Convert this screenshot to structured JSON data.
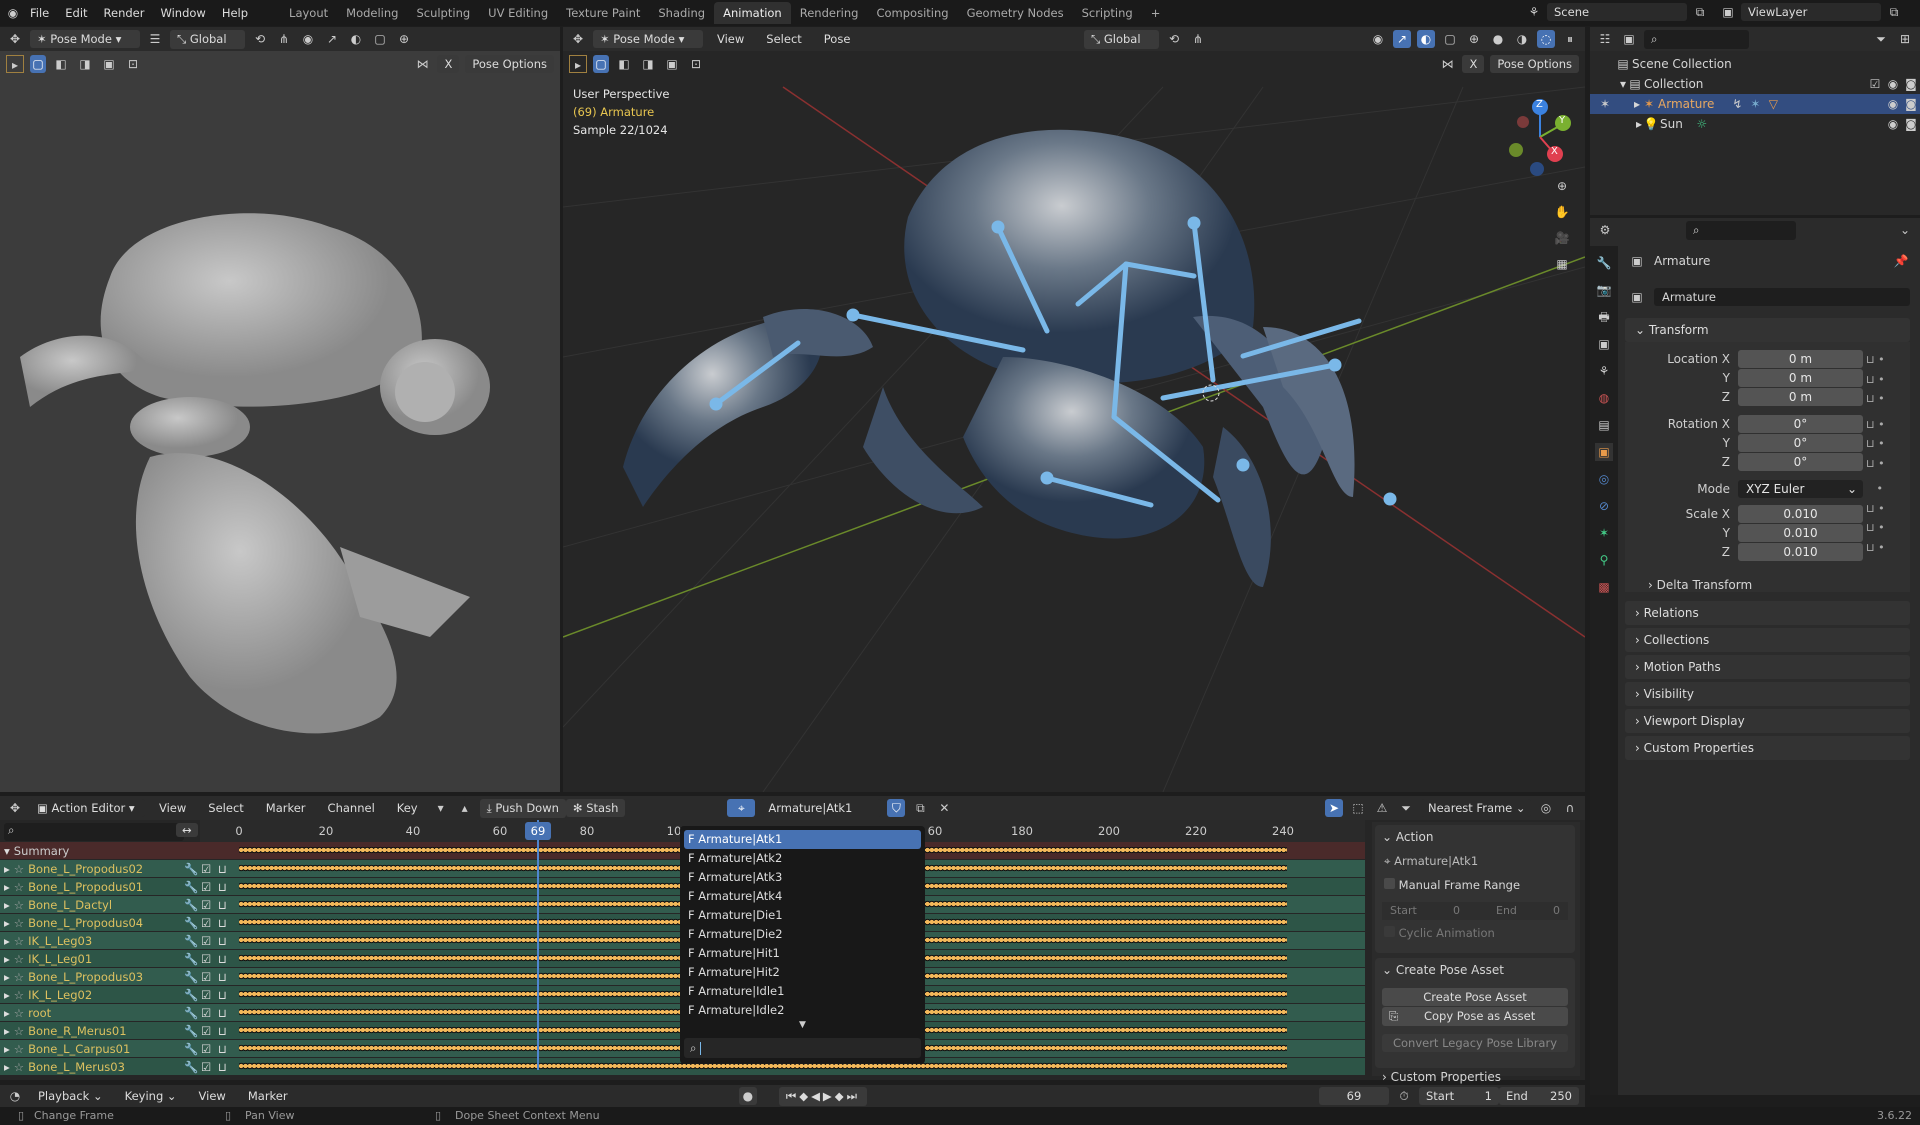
{
  "menu": [
    "File",
    "Edit",
    "Render",
    "Window",
    "Help"
  ],
  "workspaces": [
    "Layout",
    "Modeling",
    "Sculpting",
    "UV Editing",
    "Texture Paint",
    "Shading",
    "Animation",
    "Rendering",
    "Compositing",
    "Geometry Nodes",
    "Scripting"
  ],
  "active_workspace": "Animation",
  "scene": "Scene",
  "view_layer": "ViewLayer",
  "left_viewport": {
    "mode": "Pose Mode",
    "orientation": "Global",
    "pose_options": "Pose Options",
    "x_label": "X"
  },
  "main_viewport": {
    "mode": "Pose Mode",
    "menus": [
      "View",
      "Select",
      "Pose"
    ],
    "orientation": "Global",
    "pose_options": "Pose Options",
    "x_label": "X",
    "overlay": {
      "perspective": "User Perspective",
      "object": "(69) Armature",
      "sample": "Sample 22/1024"
    },
    "gizmo": {
      "z": "Z",
      "y": "Y",
      "x": "X"
    }
  },
  "outliner": {
    "items": [
      {
        "label": "Scene Collection"
      },
      {
        "label": "Collection"
      },
      {
        "label": "Armature"
      },
      {
        "label": "Sun"
      }
    ]
  },
  "properties": {
    "object_name": "Armature",
    "data_name": "Armature",
    "transform_title": "Transform",
    "location_label": "Location X",
    "rotation_label": "Rotation X",
    "scale_label": "Scale X",
    "y": "Y",
    "z": "Z",
    "location": [
      "0 m",
      "0 m",
      "0 m"
    ],
    "rotation": [
      "0°",
      "0°",
      "0°"
    ],
    "mode_label": "Mode",
    "mode": "XYZ Euler",
    "scale": [
      "0.010",
      "0.010",
      "0.010"
    ],
    "delta": "Delta Transform",
    "panels": [
      "Relations",
      "Collections",
      "Motion Paths",
      "Visibility",
      "Viewport Display",
      "Custom Properties"
    ]
  },
  "dopesheet": {
    "editor": "Action Editor",
    "menus": [
      "View",
      "Select",
      "Marker",
      "Channel",
      "Key"
    ],
    "push_down": "Push Down",
    "stash": "Stash",
    "action": "Armature|Atk1",
    "snap": "Nearest Frame",
    "ruler": [
      "0",
      "20",
      "40",
      "60",
      "80",
      "10",
      "60",
      "180",
      "200",
      "220",
      "240"
    ],
    "current_frame": "69",
    "summary": "Summary",
    "channels": [
      "Bone_L_Propodus02",
      "Bone_L_Propodus01",
      "Bone_L_Dactyl",
      "Bone_L_Propodus04",
      "IK_L_Leg03",
      "IK_L_Leg01",
      "Bone_L_Propodus03",
      "IK_L_Leg02",
      "root",
      "Bone_R_Merus01",
      "Bone_L_Carpus01",
      "Bone_L_Merus03"
    ],
    "action_list": [
      "F Armature|Atk1",
      "F Armature|Atk2",
      "F Armature|Atk3",
      "F Armature|Atk4",
      "F Armature|Die1",
      "F Armature|Die2",
      "F Armature|Hit1",
      "F Armature|Hit2",
      "F Armature|Idle1",
      "F Armature|Idle2"
    ]
  },
  "sidebar": {
    "action_title": "Action",
    "action_name": "Armature|Atk1",
    "manual_range": "Manual Frame Range",
    "start_label": "Start",
    "start": "0",
    "end_label": "End",
    "end": "0",
    "cyclic": "Cyclic Animation",
    "pose_title": "Create Pose Asset",
    "create_pose": "Create Pose Asset",
    "copy_pose": "Copy Pose as Asset",
    "convert": "Convert Legacy Pose Library",
    "custom_props": "Custom Properties"
  },
  "timeline": {
    "menus": [
      "Playback",
      "Keying",
      "View",
      "Marker"
    ],
    "frame": "69",
    "start_label": "Start",
    "start": "1",
    "end_label": "End",
    "end": "250"
  },
  "status": {
    "change_frame": "Change Frame",
    "pan_view": "Pan View",
    "context_menu": "Dope Sheet Context Menu",
    "version": "3.6.22"
  }
}
